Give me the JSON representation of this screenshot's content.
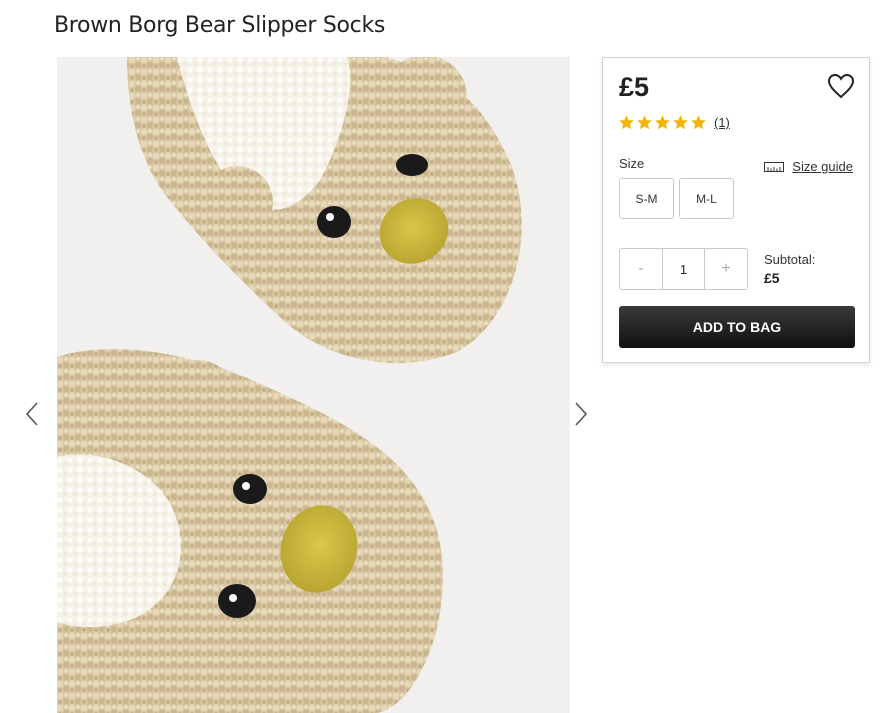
{
  "product": {
    "title": "Brown Borg Bear Slipper Socks"
  },
  "image": {
    "alt": "Brown borg bear slipper socks"
  },
  "icons": {
    "prev": "chevron-left-icon",
    "next": "chevron-right-icon",
    "wishlist": "heart-icon",
    "star": "star-icon",
    "ruler": "ruler-icon"
  },
  "colors": {
    "star": "#f4b400",
    "button": "#1a1a1a"
  },
  "purchase": {
    "price": "£5",
    "rating": {
      "stars": 5,
      "count_label": "(1)"
    },
    "size": {
      "label": "Size",
      "guide_label": "Size guide",
      "options": [
        "S-M",
        "M-L"
      ]
    },
    "quantity": {
      "minus": "-",
      "value": "1",
      "plus": "+"
    },
    "subtotal": {
      "label": "Subtotal:",
      "value": "£5"
    },
    "add_to_bag": "ADD TO BAG"
  }
}
